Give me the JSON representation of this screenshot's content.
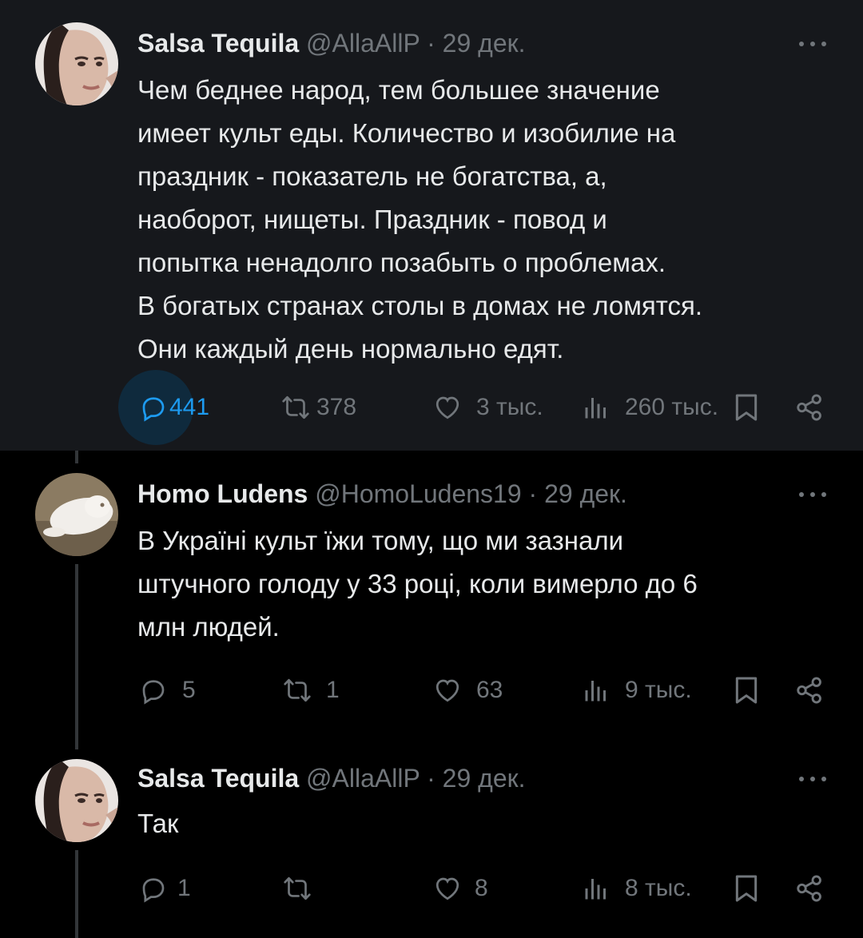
{
  "colors": {
    "background": "#000000",
    "highlight_bg": "#16181c",
    "text": "#e7e9ea",
    "muted": "#71767b",
    "accent": "#1d9bf0"
  },
  "tweets": [
    {
      "name": "Salsa Tequila",
      "handle": "@AllaAllP",
      "separator": "·",
      "date": "29 дек.",
      "lines": [
        "Чем беднее народ, тем большее значение",
        "имеет культ еды. Количество и изобилие на",
        "праздник - показатель не богатства, а,",
        "наоборот, нищеты. Праздник - повод и",
        "попытка ненадолго позабыть о проблемах.",
        "В богатых странах столы в домах не ломятся.",
        "Они каждый день нормально едят."
      ],
      "replies": "441",
      "reposts": "378",
      "likes": "3 тыс.",
      "views": "260 тыс."
    },
    {
      "name": "Homo Ludens",
      "handle": "@HomoLudens19",
      "separator": "·",
      "date": "29 дек.",
      "lines": [
        "В Україні культ їжи тому, що ми зазнали",
        "штучного голоду у 33 році, коли вимерло до 6",
        "млн людей."
      ],
      "replies": "5",
      "reposts": "1",
      "likes": "63",
      "views": "9 тыс."
    },
    {
      "name": "Salsa Tequila",
      "handle": "@AllaAllP",
      "separator": "·",
      "date": "29 дек.",
      "lines": [
        "Так"
      ],
      "replies": "1",
      "reposts": "",
      "likes": "8",
      "views": "8 тыс."
    }
  ],
  "icons": [
    "reply-icon",
    "repost-icon",
    "like-icon",
    "views-icon",
    "bookmark-icon",
    "share-icon",
    "more-icon"
  ]
}
